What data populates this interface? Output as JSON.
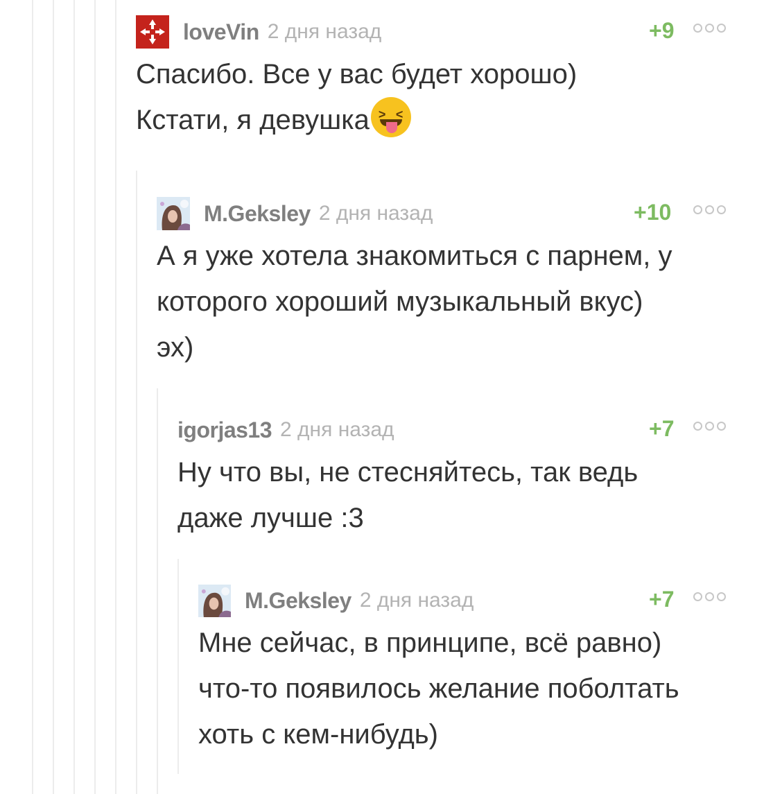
{
  "comments": [
    {
      "author": "loveVin",
      "time": "2 дня назад",
      "rating": "+9",
      "lines": [
        "Спасибо. Все у вас будет хорошо)",
        "Кстати, я девушка"
      ],
      "emoji": "squinting-face-with-tongue-emoji"
    },
    {
      "author": "M.Geksley",
      "time": "2 дня назад",
      "rating": "+10",
      "lines": [
        "А я уже хотела знакомиться с парнем, у",
        "которого хороший музыкальный вкус)",
        "эх)"
      ]
    },
    {
      "author": "igorjas13",
      "time": "2 дня назад",
      "rating": "+7",
      "lines": [
        "Ну что вы, не стесняйтесь, так ведь",
        "даже лучше :3"
      ]
    },
    {
      "author": "M.Geksley",
      "time": "2 дня назад",
      "rating": "+7",
      "lines": [
        "Мне сейчас, в принципе, всё равно)",
        "что-то появилось желание поболтать",
        "хоть с кем-нибудь)"
      ]
    }
  ],
  "colors": {
    "rating": "#7dbb61",
    "author": "#7f7f7f",
    "time": "#b3b3b3",
    "text": "#333333",
    "thread_line": "#ececec"
  },
  "icons": {
    "more_menu": "more-options-icon",
    "avatar_lovevin": "avatar-arrows-icon",
    "avatar_geksley": "avatar-girl-photo"
  }
}
